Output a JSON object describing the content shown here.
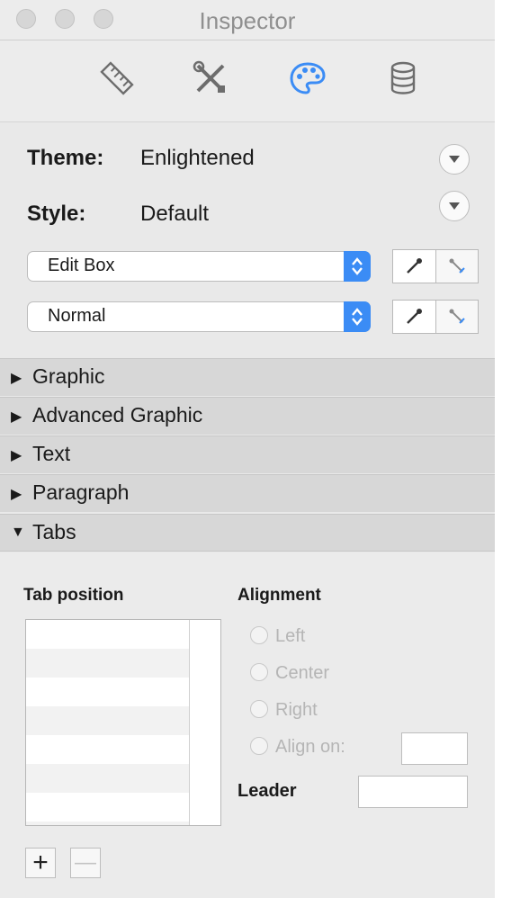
{
  "window": {
    "title": "Inspector"
  },
  "toolbar": {
    "icons": [
      "ruler-icon",
      "tools-icon",
      "palette-icon",
      "database-icon"
    ],
    "active": "palette-icon",
    "accent": "#3b8cf5"
  },
  "theme": {
    "label": "Theme:",
    "value": "Enlightened"
  },
  "style": {
    "label": "Style:",
    "value": "Default"
  },
  "popups": [
    {
      "value": "Edit Box"
    },
    {
      "value": "Normal"
    }
  ],
  "sections": [
    {
      "label": "Graphic",
      "state": "collapsed",
      "glyph": "▶"
    },
    {
      "label": "Advanced Graphic",
      "state": "collapsed",
      "glyph": "▶"
    },
    {
      "label": "Text",
      "state": "collapsed",
      "glyph": "▶"
    },
    {
      "label": "Paragraph",
      "state": "collapsed",
      "glyph": "▶"
    },
    {
      "label": "Tabs",
      "state": "expanded",
      "glyph": "▼"
    }
  ],
  "tabs": {
    "position_label": "Tab position",
    "alignment_label": "Alignment",
    "alignments": [
      "Left",
      "Center",
      "Right",
      "Align on:"
    ],
    "leader_label": "Leader",
    "add": "+",
    "remove": "—"
  }
}
